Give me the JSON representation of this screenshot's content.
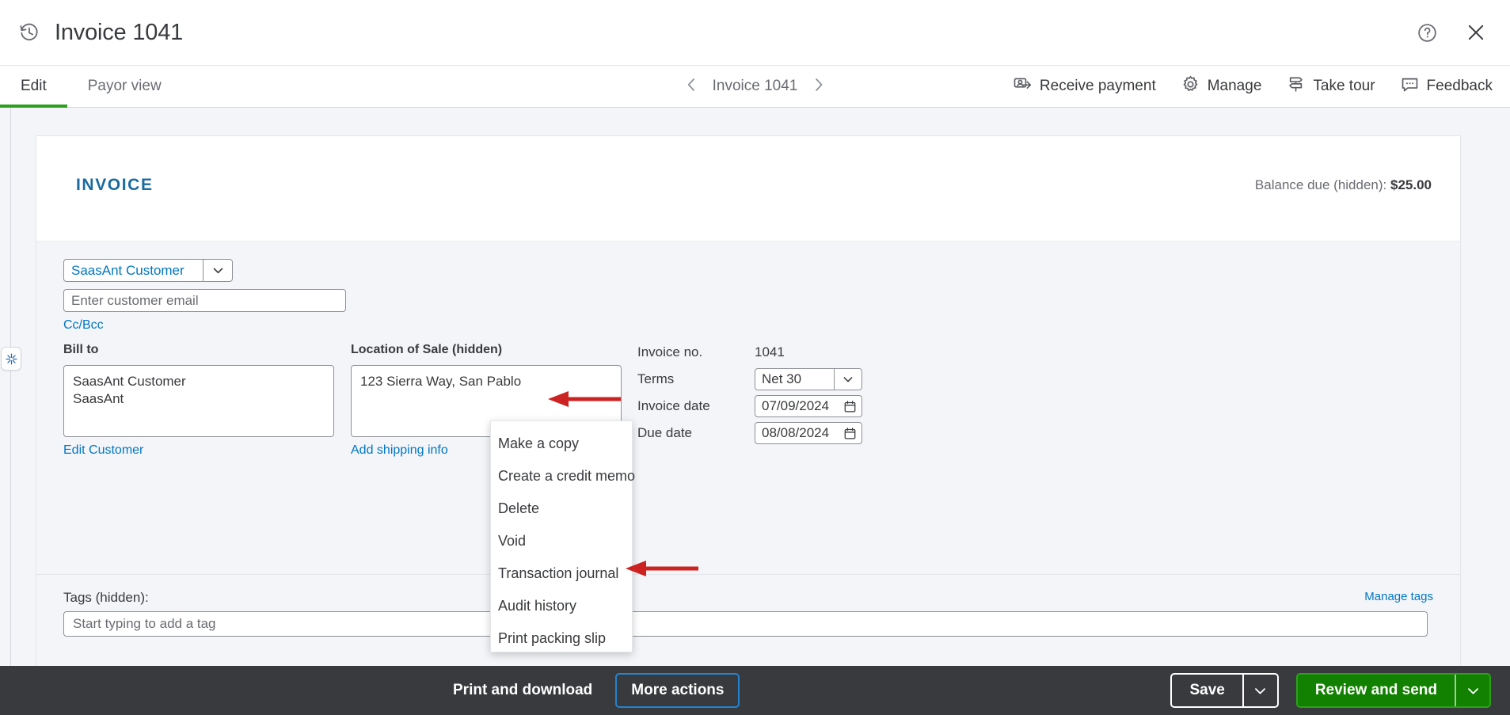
{
  "header": {
    "title": "Invoice 1041",
    "history_icon": "history-clock-icon",
    "help_icon": "help-circle-icon",
    "close_icon": "close-x-icon"
  },
  "toolbar": {
    "tabs": [
      {
        "label": "Edit",
        "active": true
      },
      {
        "label": "Payor view",
        "active": false
      }
    ],
    "nav": {
      "prev_icon": "chevron-left-icon",
      "label": "Invoice 1041",
      "next_icon": "chevron-right-icon"
    },
    "actions": [
      {
        "label": "Receive payment",
        "icon": "receive-payment-icon"
      },
      {
        "label": "Manage",
        "icon": "gear-icon"
      },
      {
        "label": "Take tour",
        "icon": "signpost-icon"
      },
      {
        "label": "Feedback",
        "icon": "comment-icon"
      }
    ]
  },
  "sheet": {
    "invoice_word": "INVOICE",
    "balance_label": "Balance due (hidden):",
    "balance_value": "$25.00",
    "customer": {
      "selected": "SaasAnt Customer",
      "dropdown_icon": "chevron-down-icon"
    },
    "email": {
      "placeholder": "Enter customer email",
      "value": ""
    },
    "ccbcc_label": "Cc/Bcc",
    "bill_to": {
      "label": "Bill to",
      "lines": [
        "SaasAnt Customer",
        "SaasAnt"
      ],
      "link": "Edit Customer"
    },
    "location_of_sale": {
      "label": "Location of Sale (hidden)",
      "value": "123 Sierra Way, San Pablo",
      "link": "Add shipping info"
    },
    "meta": {
      "invoice_no_label": "Invoice no.",
      "invoice_no_value": "1041",
      "terms_label": "Terms",
      "terms_value": "Net 30",
      "invoice_date_label": "Invoice date",
      "invoice_date_value": "07/09/2024",
      "due_date_label": "Due date",
      "due_date_value": "08/08/2024",
      "calendar_icon": "calendar-icon",
      "dropdown_icon": "chevron-down-icon"
    },
    "tags": {
      "label": "Tags (hidden):",
      "placeholder": "Start typing to add a tag",
      "value": "",
      "manage_link": "Manage tags"
    }
  },
  "menu": {
    "items": [
      "Make a copy",
      "Create a credit memo",
      "Delete",
      "Void",
      "Transaction journal",
      "Audit history",
      "Print packing slip"
    ]
  },
  "footer": {
    "print_label": "Print and download",
    "more_actions_label": "More actions",
    "save_label": "Save",
    "save_caret_icon": "chevron-down-icon",
    "review_label": "Review and send",
    "review_caret_icon": "chevron-down-icon"
  },
  "annotations": {
    "arrow_color": "#cc2222",
    "arrow_to_delete": "points at Delete menu item",
    "arrow_to_more_actions": "points at More actions button"
  },
  "colors": {
    "accent_green": "#2ca01c",
    "link_blue": "#0077c5",
    "invoice_title_blue": "#1a6ba0",
    "footer_dark": "#393a3d",
    "canvas_grey": "#f4f5f8"
  },
  "sidebar": {
    "collapse_icon": "collapse-panel-icon"
  }
}
